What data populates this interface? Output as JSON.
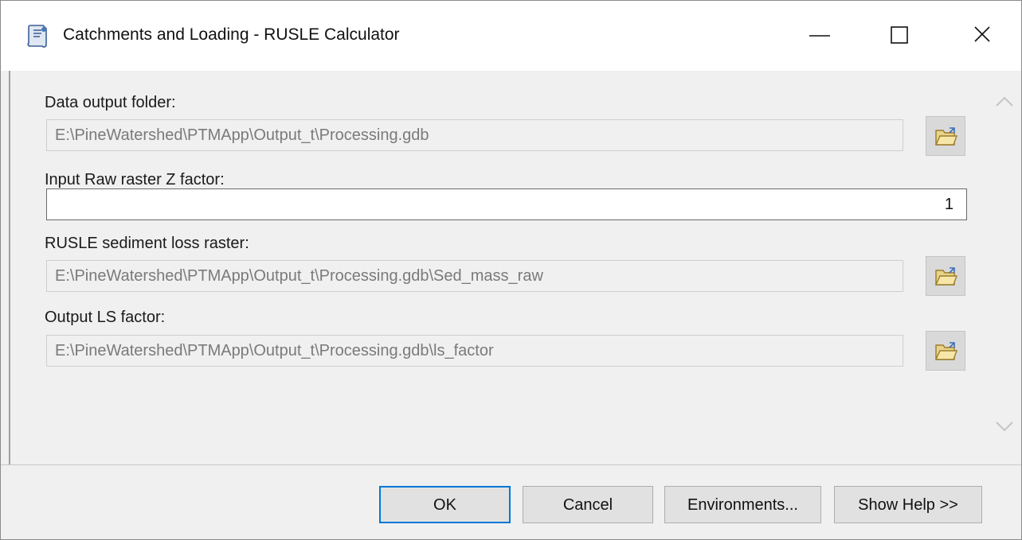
{
  "window": {
    "title": "Catchments and Loading - RUSLE Calculator",
    "app_icon": "script-tool-icon"
  },
  "controls": {
    "minimize_icon": "minimize-icon",
    "maximize_icon": "maximize-icon",
    "close_icon": "close-icon"
  },
  "fields": {
    "output_folder": {
      "label": "Data output folder:",
      "value": "E:\\PineWatershed\\PTMApp\\Output_t\\Processing.gdb"
    },
    "z_factor": {
      "label": "Input Raw raster Z factor:",
      "value": "1"
    },
    "sediment_loss": {
      "label": "RUSLE sediment loss raster:",
      "value": "E:\\PineWatershed\\PTMApp\\Output_t\\Processing.gdb\\Sed_mass_raw"
    },
    "ls_factor": {
      "label": "Output LS factor:",
      "value": "E:\\PineWatershed\\PTMApp\\Output_t\\Processing.gdb\\ls_factor"
    }
  },
  "buttons": {
    "ok": "OK",
    "cancel": "Cancel",
    "environments": "Environments...",
    "show_help": "Show Help >>"
  },
  "colors": {
    "default_button_border": "#0078d7",
    "disabled_text": "#7a7a7a",
    "folder_icon": "#e8d38a"
  }
}
